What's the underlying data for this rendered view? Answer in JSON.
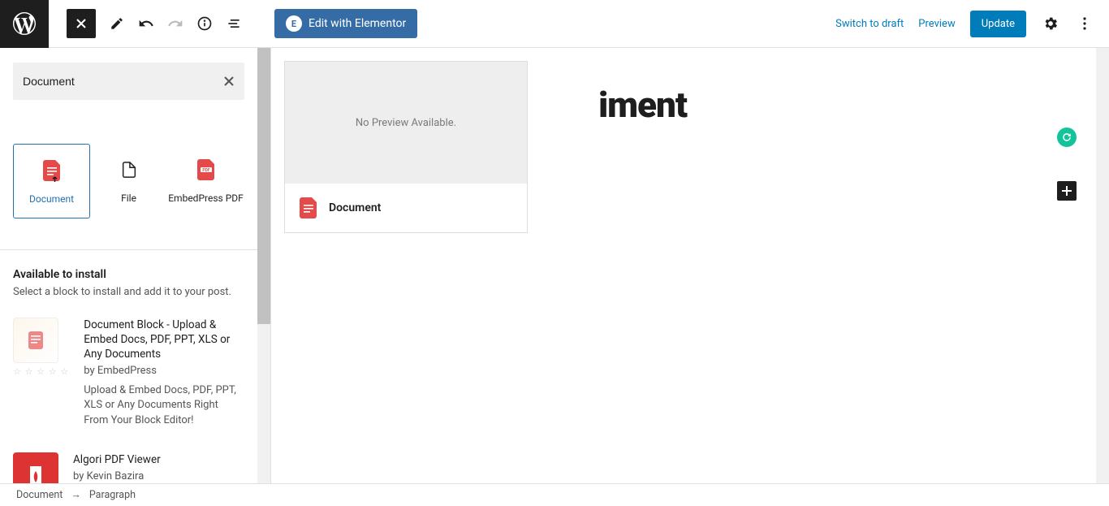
{
  "toolbar": {
    "elementor_label": "Edit with Elementor",
    "switch_draft": "Switch to draft",
    "preview": "Preview",
    "update": "Update"
  },
  "inserter": {
    "search_value": "Document",
    "blocks": [
      {
        "label": "Document"
      },
      {
        "label": "File"
      },
      {
        "label": "EmbedPress PDF"
      }
    ],
    "install_heading": "Available to install",
    "install_sub": "Select a block to install and add it to your post.",
    "items": [
      {
        "title": "Document Block - Upload & Embed Docs, PDF, PPT, XLS or Any Documents",
        "author": "by EmbedPress",
        "desc": "Upload & Embed Docs, PDF, PPT, XLS or Any Documents Right From Your Block Editor!"
      },
      {
        "title": "Algori PDF Viewer",
        "author": "by Kevin Bazira",
        "desc": ""
      }
    ]
  },
  "canvas": {
    "title_fragment": "iment",
    "no_preview": "No Preview Available.",
    "block_label": "Document"
  },
  "breadcrumb": {
    "a": "Document",
    "b": "Paragraph"
  }
}
